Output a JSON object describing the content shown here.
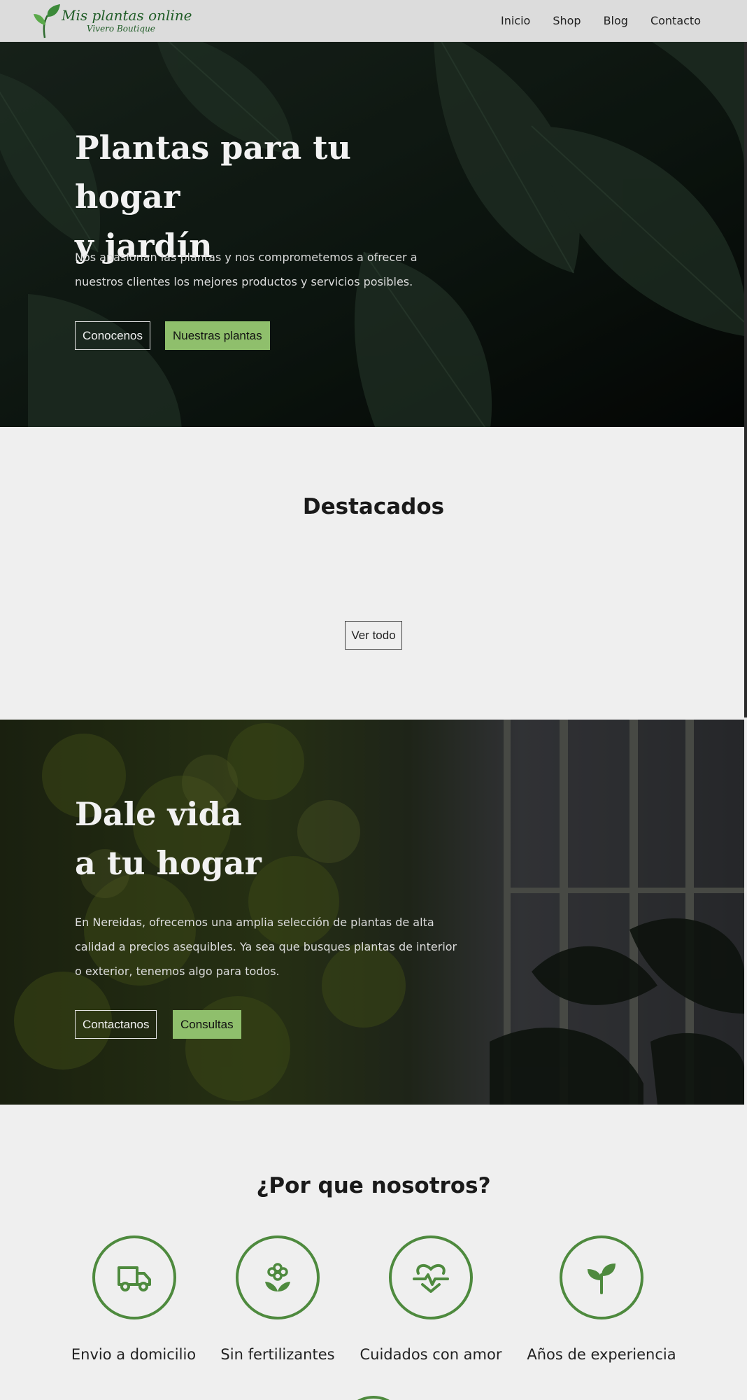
{
  "header": {
    "logo_title": "Mis plantas online",
    "logo_subtitle": "Vivero Boutique",
    "nav": [
      "Inicio",
      "Shop",
      "Blog",
      "Contacto"
    ]
  },
  "hero": {
    "title_line1": "Plantas para tu hogar",
    "title_line2": "y jardín",
    "text": "Nos apasionan las plantas y nos comprometemos a ofrecer a nuestros clientes los mejores productos y servicios posibles.",
    "btn_primary": "Conocenos",
    "btn_secondary": "Nuestras plantas"
  },
  "featured": {
    "title": "Destacados",
    "btn": "Ver todo"
  },
  "banner2": {
    "title_line1": "Dale vida",
    "title_line2": "a tu hogar",
    "text": "En Nereidas, ofrecemos una amplia selección de plantas de alta calidad a precios asequibles. Ya sea que busques plantas de interior o exterior, tenemos algo para todos.",
    "btn_primary": "Contactanos",
    "btn_secondary": "Consultas"
  },
  "why": {
    "title": "¿Por que nosotros?",
    "features": [
      {
        "label": "Envio a domicilio",
        "icon": "truck-icon"
      },
      {
        "label": "Sin fertilizantes",
        "icon": "flower-icon"
      },
      {
        "label": "Cuidados con amor",
        "icon": "heart-pulse-icon"
      },
      {
        "label": "Años de experiencia",
        "icon": "sprout-icon"
      }
    ]
  },
  "colors": {
    "accent_green": "#8fbf6c",
    "icon_green": "#4e8a3e",
    "logo_green": "#1f5c26"
  }
}
